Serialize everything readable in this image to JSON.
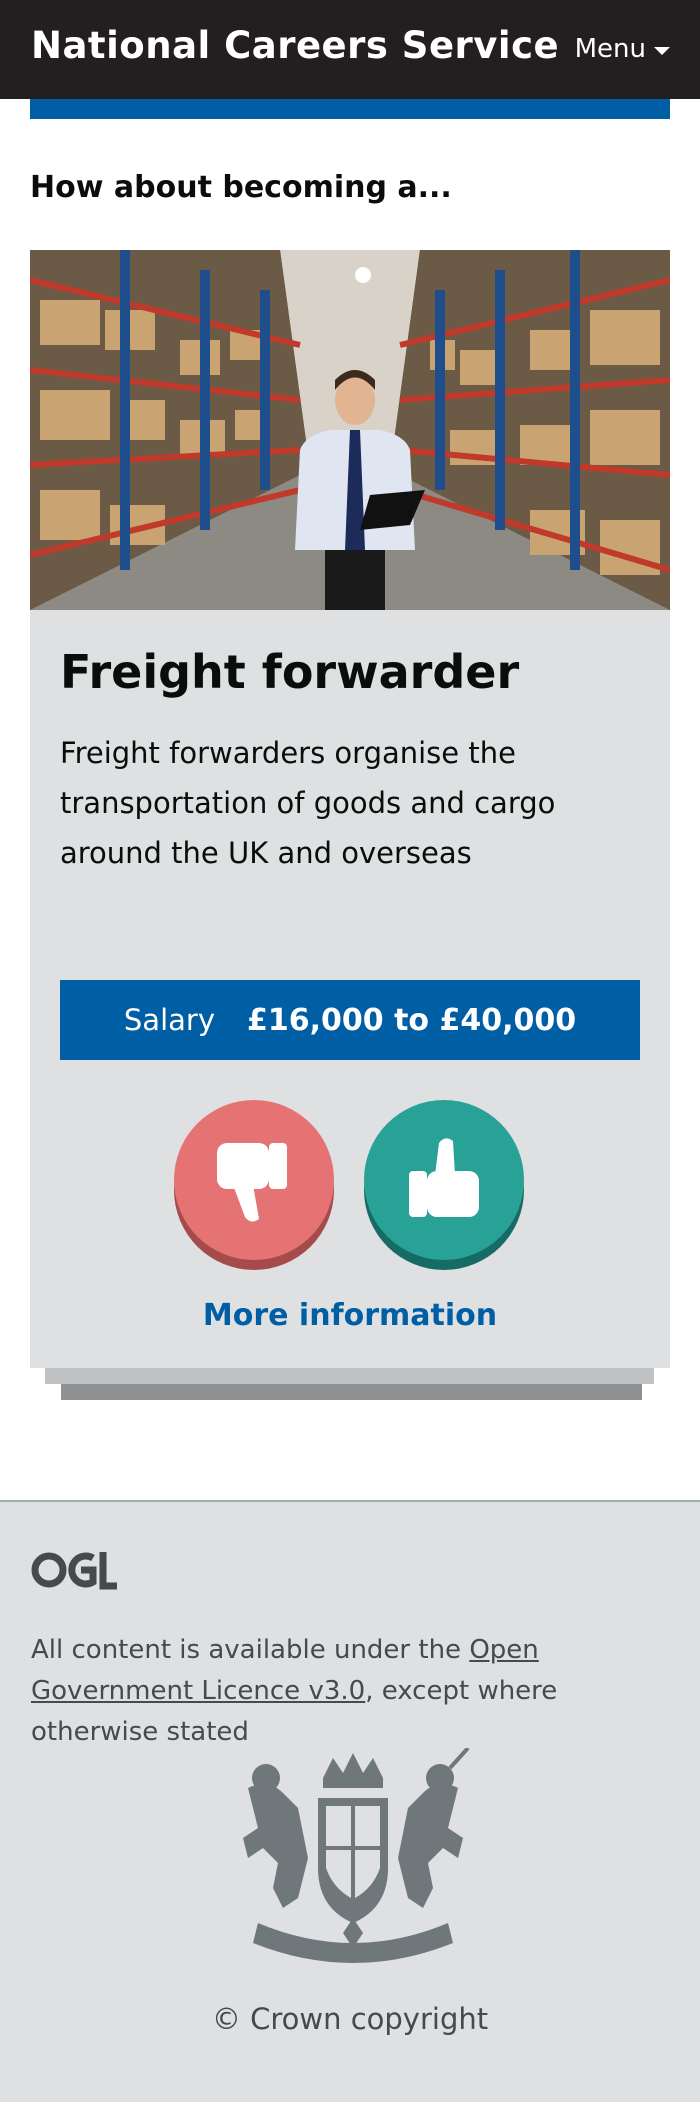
{
  "header": {
    "title": "National Careers Service",
    "menu_label": "Menu"
  },
  "section": {
    "heading": "How about becoming a..."
  },
  "card": {
    "job_title": "Freight forwarder",
    "description": "Freight forwarders organise the transportation of goods and cargo around the UK and overseas",
    "salary_label": "Salary",
    "salary_value": "£16,000 to £40,000",
    "dislike_icon": "thumbs-down-icon",
    "like_icon": "thumbs-up-icon",
    "more_info_label": "More information"
  },
  "footer": {
    "logo_text": "OGL",
    "licence_prefix": "All content is available under the ",
    "licence_link": "Open Government Licence v3.0",
    "licence_suffix": ", except where otherwise stated",
    "copyright": "© Crown copyright"
  },
  "colors": {
    "header_bg": "#231f20",
    "brand_blue": "#005ea5",
    "card_bg": "#dee0e2",
    "dislike": "#e57373",
    "like": "#28a197",
    "footer_bg": "#dee0e2"
  }
}
